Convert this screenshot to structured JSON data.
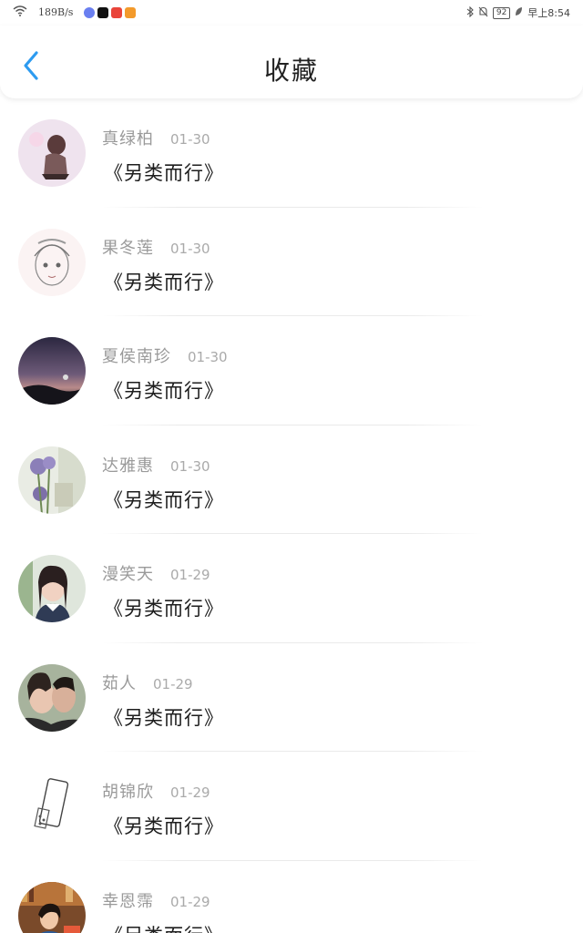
{
  "status_bar": {
    "speed": "189B/s",
    "battery": "92",
    "time": "早上8:54",
    "icons": [
      "wifi-icon",
      "music-app-icon",
      "tiktok-app-icon",
      "shopping-app-icon",
      "video-app-icon",
      "bluetooth-icon",
      "mute-icon",
      "battery-icon",
      "leaf-icon"
    ]
  },
  "header": {
    "title": "收藏",
    "back_icon": "chevron-left-icon",
    "accent": "#2d9bf0"
  },
  "favorites": [
    {
      "name": "真绿柏",
      "date": "01-30",
      "work": "《另类而行》",
      "avatar": "avatar-girl-pink"
    },
    {
      "name": "果冬莲",
      "date": "01-30",
      "work": "《另类而行》",
      "avatar": "avatar-sketch-girl"
    },
    {
      "name": "夏侯南珍",
      "date": "01-30",
      "work": "《另类而行》",
      "avatar": "avatar-night-sky"
    },
    {
      "name": "达雅惠",
      "date": "01-30",
      "work": "《另类而行》",
      "avatar": "avatar-lavender"
    },
    {
      "name": "漫笑天",
      "date": "01-29",
      "work": "《另类而行》",
      "avatar": "avatar-woman-portrait"
    },
    {
      "name": "茹人",
      "date": "01-29",
      "work": "《另类而行》",
      "avatar": "avatar-couple"
    },
    {
      "name": "胡锦欣",
      "date": "01-29",
      "work": "《另类而行》",
      "avatar": "avatar-phone-sketch"
    },
    {
      "name": "幸恩霈",
      "date": "01-29",
      "work": "《另类而行》",
      "avatar": "avatar-library"
    }
  ]
}
